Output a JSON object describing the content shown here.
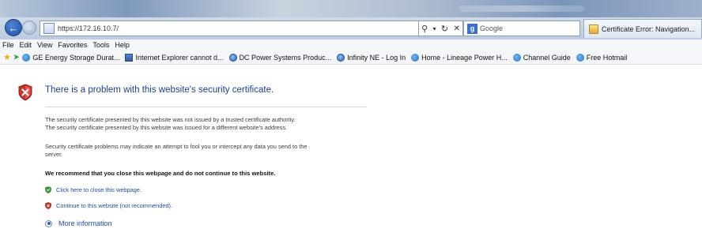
{
  "browser": {
    "address": "https://172.16.10.7/",
    "search_provider": "Google",
    "tab_title": "Certificate Error: Navigation..."
  },
  "menu": [
    "File",
    "Edit",
    "View",
    "Favorites",
    "Tools",
    "Help"
  ],
  "favorites": [
    {
      "label": "GE Energy Storage Durat...",
      "icon": "ie-icon"
    },
    {
      "label": "Internet Explorer cannot d...",
      "icon": "page-icon"
    },
    {
      "label": "DC Power Systems Produc...",
      "icon": "globe-icon"
    },
    {
      "label": "Infinity NE - Log In",
      "icon": "globe-icon"
    },
    {
      "label": "Home - Lineage Power H...",
      "icon": "ie-icon"
    },
    {
      "label": "Channel Guide",
      "icon": "ie-icon"
    },
    {
      "label": "Free Hotmail",
      "icon": "ie-icon"
    }
  ],
  "content": {
    "heading": "There is a problem with this website's security certificate.",
    "p1": "The security certificate presented by this website was not issued by a trusted certificate authority.",
    "p2": "The security certificate presented by this website was issued for a different website's address.",
    "p3": "Security certificate problems may indicate an attempt to fool you or intercept any data you send to the",
    "p4": "server.",
    "recommend": "We recommend that you close this webpage and do not continue to this website.",
    "close_link": "Click here to close this webpage.",
    "continue_link": "Continue to this website (not recommended).",
    "more_info": "More information"
  }
}
